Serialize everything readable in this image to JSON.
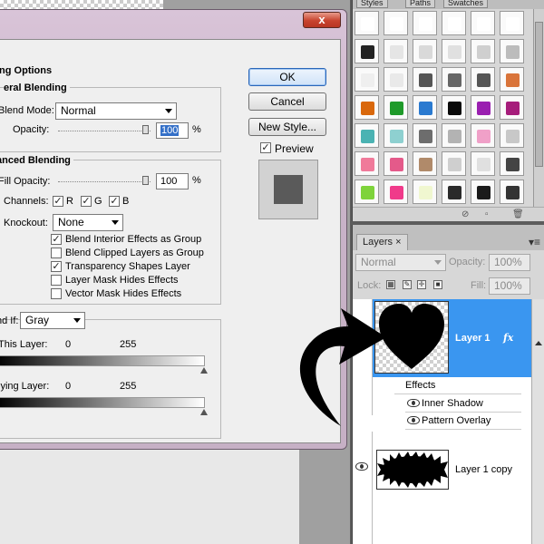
{
  "dialog": {
    "close_label": "x",
    "blending_options_title": "ing Options",
    "general_blending_title": "eral Blending",
    "blend_mode_label": "Blend Mode:",
    "blend_mode_value": "Normal",
    "opacity_label": "Opacity:",
    "opacity_value": "100",
    "opacity_unit": "%",
    "advanced_blending_title": "anced Blending",
    "fill_opacity_label": "Fill Opacity:",
    "fill_opacity_value": "100",
    "fill_opacity_unit": "%",
    "channels_label": "Channels:",
    "channels": [
      {
        "label": "R",
        "checked": true
      },
      {
        "label": "G",
        "checked": true
      },
      {
        "label": "B",
        "checked": true
      }
    ],
    "knockout_label": "Knockout:",
    "knockout_value": "None",
    "options": [
      {
        "label": "Blend Interior Effects as Group",
        "checked": true
      },
      {
        "label": "Blend Clipped Layers as Group",
        "checked": false
      },
      {
        "label": "Transparency Shapes Layer",
        "checked": true
      },
      {
        "label": "Layer Mask Hides Effects",
        "checked": false
      },
      {
        "label": "Vector Mask Hides Effects",
        "checked": false
      }
    ],
    "blend_if_label": "nd If:",
    "blend_if_value": "Gray",
    "this_layer_label": "This Layer:",
    "this_layer_min": "0",
    "this_layer_max": "255",
    "underlying_layer_label": "lying Layer:",
    "underlying_min": "0",
    "underlying_max": "255",
    "ok_label": "OK",
    "cancel_label": "Cancel",
    "new_style_label": "New Style...",
    "preview_label": "Preview",
    "preview_checked": true
  },
  "styles_panel": {
    "tabs": [
      "Styles",
      "Paths",
      "Swatches"
    ],
    "swatch_colors": [
      [
        "#ffffff",
        "#ffffff",
        "#ffffff",
        "#ffffff",
        "#ffffff",
        "#ffffff"
      ],
      [
        "#222222",
        "#e5e5e5",
        "#d9d9d9",
        "#e0e0e0",
        "#cfcfcf",
        "#bcbcbc"
      ],
      [
        "#efefef",
        "#e9e9e9",
        "#555555",
        "#666666",
        "#555555",
        "#d9743a"
      ],
      [
        "#d9680c",
        "#1f9a2a",
        "#2a7ad0",
        "#0a0a0a",
        "#9a1fb0",
        "#a61d7b"
      ],
      [
        "#4bb3b3",
        "#8ed0d0",
        "#6d6d6d",
        "#b3b3b3",
        "#f0a0c8",
        "#c8c8c8"
      ],
      [
        "#f07a9a",
        "#e45a8a",
        "#b08a6a",
        "#cfcfcf",
        "#e0e0e0",
        "#444444"
      ],
      [
        "#7ed33a",
        "#f03a8a",
        "#f0f7d0",
        "#2a2a2a",
        "#1a1a1a",
        "#333333"
      ]
    ]
  },
  "layers_panel": {
    "tab_label": "Layers",
    "blend_mode": "Normal",
    "opacity_label": "Opacity:",
    "opacity_value": "100%",
    "lock_label": "Lock:",
    "fill_label": "Fill:",
    "fill_value": "100%",
    "layers": [
      {
        "name": "Layer 1",
        "fx": "fx",
        "selected": true
      },
      {
        "name": "Layer 1 copy",
        "selected": false
      }
    ],
    "effects_label": "Effects",
    "effects": [
      "Inner Shadow",
      "Pattern Overlay"
    ]
  }
}
